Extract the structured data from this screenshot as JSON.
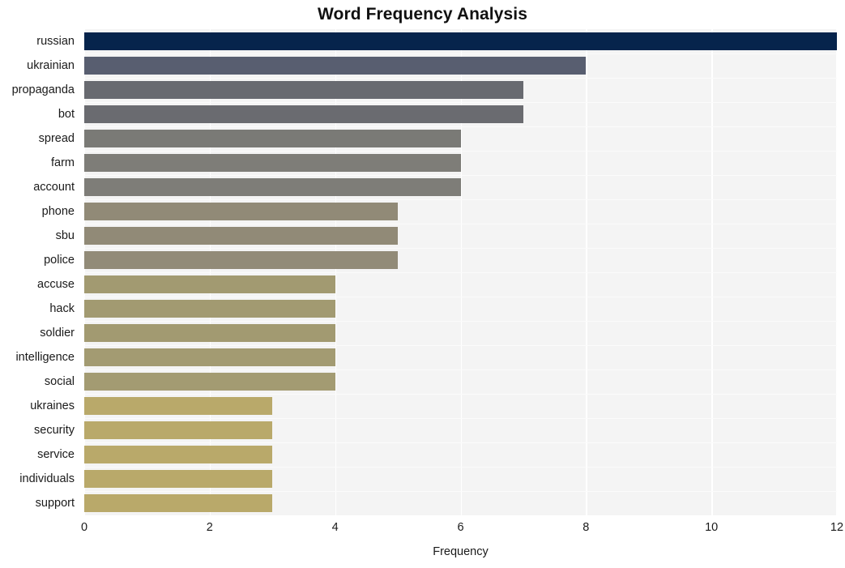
{
  "chart_data": {
    "type": "bar",
    "orientation": "horizontal",
    "title": "Word Frequency Analysis",
    "xlabel": "Frequency",
    "ylabel": "",
    "xlim": [
      0,
      12
    ],
    "xticks": [
      0,
      2,
      4,
      6,
      8,
      10,
      12
    ],
    "grid": true,
    "grid_axis": "x",
    "legend": false,
    "categories": [
      "russian",
      "ukrainian",
      "propaganda",
      "bot",
      "spread",
      "farm",
      "account",
      "phone",
      "sbu",
      "police",
      "accuse",
      "hack",
      "soldier",
      "intelligence",
      "social",
      "ukraines",
      "security",
      "service",
      "individuals",
      "support"
    ],
    "values": [
      12,
      8,
      7,
      7,
      6,
      6,
      6,
      5,
      5,
      5,
      4,
      4,
      4,
      4,
      4,
      3,
      3,
      3,
      3,
      3
    ],
    "bar_colors": [
      "#06244c",
      "#585e70",
      "#686a70",
      "#6a6b70",
      "#7a7a76",
      "#7e7d78",
      "#7e7d78",
      "#918a77",
      "#918a77",
      "#928b78",
      "#a29a71",
      "#a29a71",
      "#a29a71",
      "#a39b72",
      "#a39b72",
      "#b9a96a",
      "#b9a96a",
      "#b9a96a",
      "#b9a96a",
      "#b9a96a"
    ]
  },
  "style": {
    "plot_background": "#f4f4f4",
    "figure_background": "#ffffff",
    "gridline_color": "#ffffff",
    "text_color": "#1a1a1a",
    "title_color": "#111111"
  }
}
